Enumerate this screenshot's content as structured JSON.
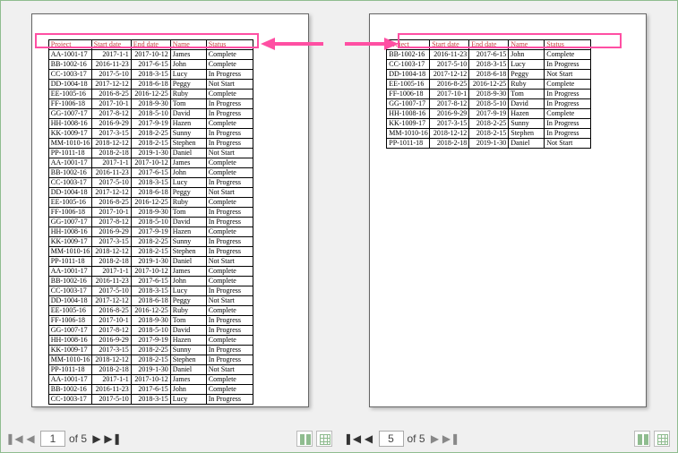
{
  "headers": {
    "project": "Project",
    "start": "Start date",
    "end": "End date",
    "name": "Name",
    "status": "Status"
  },
  "nav": {
    "page1": "1",
    "page5": "5",
    "of5": "of 5"
  },
  "chart_data": {
    "type": "table",
    "columns": [
      "Project",
      "Start date",
      "End date",
      "Name",
      "Status"
    ],
    "page1_rows": [
      [
        "AA-1001-17",
        "2017-1-1",
        "2017-10-12",
        "James",
        "Complete"
      ],
      [
        "BB-1002-16",
        "2016-11-23",
        "2017-6-15",
        "John",
        "Complete"
      ],
      [
        "CC-1003-17",
        "2017-5-10",
        "2018-3-15",
        "Lucy",
        "In Progress"
      ],
      [
        "DD-1004-18",
        "2017-12-12",
        "2018-6-18",
        "Peggy",
        "Not Start"
      ],
      [
        "EE-1005-16",
        "2016-8-25",
        "2016-12-25",
        "Ruby",
        "Complete"
      ],
      [
        "FF-1006-18",
        "2017-10-1",
        "2018-9-30",
        "Tom",
        "In Progress"
      ],
      [
        "GG-1007-17",
        "2017-8-12",
        "2018-5-10",
        "David",
        "In Progress"
      ],
      [
        "HH-1008-16",
        "2016-9-29",
        "2017-9-19",
        "Hazen",
        "Complete"
      ],
      [
        "KK-1009-17",
        "2017-3-15",
        "2018-2-25",
        "Sunny",
        "In Progress"
      ],
      [
        "MM-1010-16",
        "2018-12-12",
        "2018-2-15",
        "Stephen",
        "In Progress"
      ],
      [
        "PP-1011-18",
        "2018-2-18",
        "2019-1-30",
        "Daniel",
        "Not Start"
      ],
      [
        "AA-1001-17",
        "2017-1-1",
        "2017-10-12",
        "James",
        "Complete"
      ],
      [
        "BB-1002-16",
        "2016-11-23",
        "2017-6-15",
        "John",
        "Complete"
      ],
      [
        "CC-1003-17",
        "2017-5-10",
        "2018-3-15",
        "Lucy",
        "In Progress"
      ],
      [
        "DD-1004-18",
        "2017-12-12",
        "2018-6-18",
        "Peggy",
        "Not Start"
      ],
      [
        "EE-1005-16",
        "2016-8-25",
        "2016-12-25",
        "Ruby",
        "Complete"
      ],
      [
        "FF-1006-18",
        "2017-10-1",
        "2018-9-30",
        "Tom",
        "In Progress"
      ],
      [
        "GG-1007-17",
        "2017-8-12",
        "2018-5-10",
        "David",
        "In Progress"
      ],
      [
        "HH-1008-16",
        "2016-9-29",
        "2017-9-19",
        "Hazen",
        "Complete"
      ],
      [
        "KK-1009-17",
        "2017-3-15",
        "2018-2-25",
        "Sunny",
        "In Progress"
      ],
      [
        "MM-1010-16",
        "2018-12-12",
        "2018-2-15",
        "Stephen",
        "In Progress"
      ],
      [
        "PP-1011-18",
        "2018-2-18",
        "2019-1-30",
        "Daniel",
        "Not Start"
      ],
      [
        "AA-1001-17",
        "2017-1-1",
        "2017-10-12",
        "James",
        "Complete"
      ],
      [
        "BB-1002-16",
        "2016-11-23",
        "2017-6-15",
        "John",
        "Complete"
      ],
      [
        "CC-1003-17",
        "2017-5-10",
        "2018-3-15",
        "Lucy",
        "In Progress"
      ],
      [
        "DD-1004-18",
        "2017-12-12",
        "2018-6-18",
        "Peggy",
        "Not Start"
      ],
      [
        "EE-1005-16",
        "2016-8-25",
        "2016-12-25",
        "Ruby",
        "Complete"
      ],
      [
        "FF-1006-18",
        "2017-10-1",
        "2018-9-30",
        "Tom",
        "In Progress"
      ],
      [
        "GG-1007-17",
        "2017-8-12",
        "2018-5-10",
        "David",
        "In Progress"
      ],
      [
        "HH-1008-16",
        "2016-9-29",
        "2017-9-19",
        "Hazen",
        "Complete"
      ],
      [
        "KK-1009-17",
        "2017-3-15",
        "2018-2-25",
        "Sunny",
        "In Progress"
      ],
      [
        "MM-1010-16",
        "2018-12-12",
        "2018-2-15",
        "Stephen",
        "In Progress"
      ],
      [
        "PP-1011-18",
        "2018-2-18",
        "2019-1-30",
        "Daniel",
        "Not Start"
      ],
      [
        "AA-1001-17",
        "2017-1-1",
        "2017-10-12",
        "James",
        "Complete"
      ],
      [
        "BB-1002-16",
        "2016-11-23",
        "2017-6-15",
        "John",
        "Complete"
      ],
      [
        "CC-1003-17",
        "2017-5-10",
        "2018-3-15",
        "Lucy",
        "In Progress"
      ]
    ],
    "page5_rows": [
      [
        "BB-1002-16",
        "2016-11-23",
        "2017-6-15",
        "John",
        "Complete"
      ],
      [
        "CC-1003-17",
        "2017-5-10",
        "2018-3-15",
        "Lucy",
        "In Progress"
      ],
      [
        "DD-1004-18",
        "2017-12-12",
        "2018-6-18",
        "Peggy",
        "Not Start"
      ],
      [
        "EE-1005-16",
        "2016-8-25",
        "2016-12-25",
        "Ruby",
        "Complete"
      ],
      [
        "FF-1006-18",
        "2017-10-1",
        "2018-9-30",
        "Tom",
        "In Progress"
      ],
      [
        "GG-1007-17",
        "2017-8-12",
        "2018-5-10",
        "David",
        "In Progress"
      ],
      [
        "HH-1008-16",
        "2016-9-29",
        "2017-9-19",
        "Hazen",
        "Complete"
      ],
      [
        "KK-1009-17",
        "2017-3-15",
        "2018-2-25",
        "Sunny",
        "In Progress"
      ],
      [
        "MM-1010-16",
        "2018-12-12",
        "2018-2-15",
        "Stephen",
        "In Progress"
      ],
      [
        "PP-1011-18",
        "2018-2-18",
        "2019-1-30",
        "Daniel",
        "Not Start"
      ]
    ]
  }
}
